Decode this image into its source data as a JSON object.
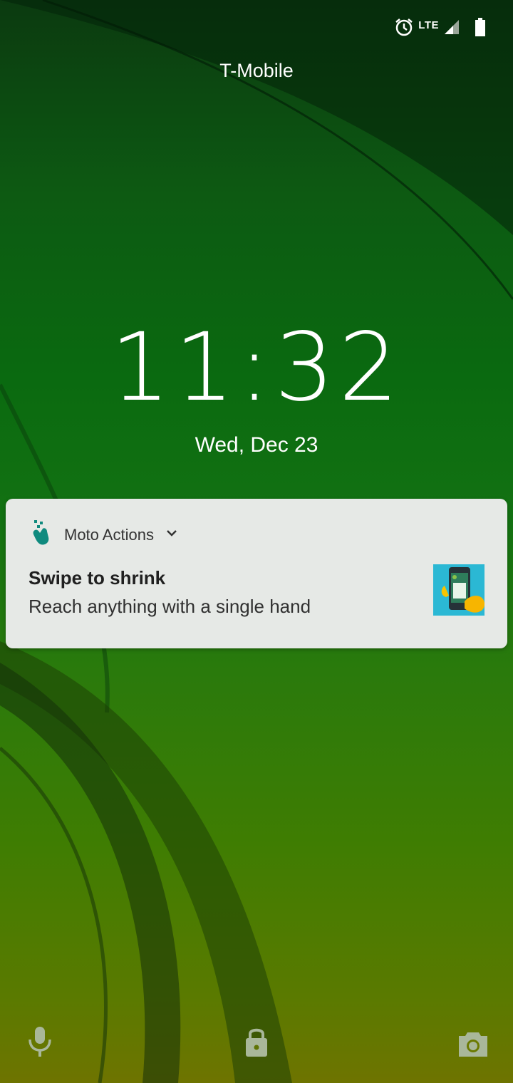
{
  "status_bar": {
    "network_label": "LTE",
    "icons": [
      "alarm-icon",
      "signal-icon",
      "battery-icon"
    ]
  },
  "lockscreen": {
    "carrier": "T-Mobile",
    "time": "11:32",
    "date": "Wed, Dec 23"
  },
  "notification": {
    "app_name": "Moto Actions",
    "title": "Swipe to shrink",
    "text": "Reach anything with a single hand",
    "app_icon": "moto-actions-icon",
    "thumbnail": "one-hand-phone-illustration"
  },
  "bottom_actions": [
    "microphone-icon",
    "lock-icon",
    "camera-icon"
  ],
  "colors": {
    "notification_bg": "#e6e9e6",
    "accent_teal": "#0f8a7e",
    "thumb_bg": "#2bb8d4",
    "wallpaper_top": "#0b3a10",
    "wallpaper_bottom": "#6e7400"
  }
}
